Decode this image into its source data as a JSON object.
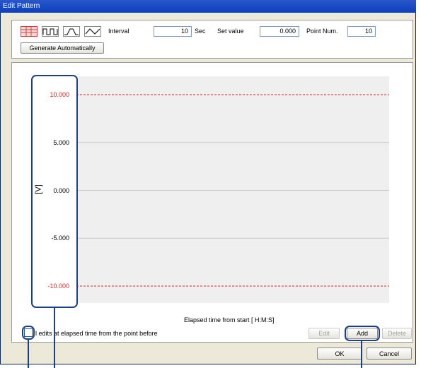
{
  "window": {
    "title": "Edit Pattern"
  },
  "toolbar": {
    "pattern_icons": [
      "grid-pattern-icon",
      "square-wave-icon",
      "trapezoid-wave-icon",
      "triangle-wave-icon"
    ],
    "interval_label": "Interval",
    "interval_value": "10",
    "interval_unit": "Sec",
    "set_value_label": "Set value",
    "set_value_value": "0.000",
    "point_num_label": "Point Num.",
    "point_num_value": "10",
    "generate_button": "Generate Automatically"
  },
  "chart_data": {
    "type": "line",
    "ylabel": "[V]",
    "xlabel": "Elapsed time from start [ H:M:S]",
    "yticks": [
      "10.000",
      "5.000",
      "0.000",
      "-5.000",
      "-10.000"
    ],
    "ylim": [
      -10,
      10
    ],
    "limit_lines": [
      10,
      -10
    ],
    "limit_color": "#e02020",
    "grid": true
  },
  "footer": {
    "checkbox_label": "l edits at elapsed time from the point before",
    "edit_button": "Edit",
    "add_button": "Add",
    "delete_button": "Delete",
    "ok_button": "OK",
    "cancel_button": "Cancel"
  },
  "colors": {
    "title_bar": "#0a3fbf",
    "annotation": "#1c3f8a",
    "plot_bg": "#efefef"
  }
}
